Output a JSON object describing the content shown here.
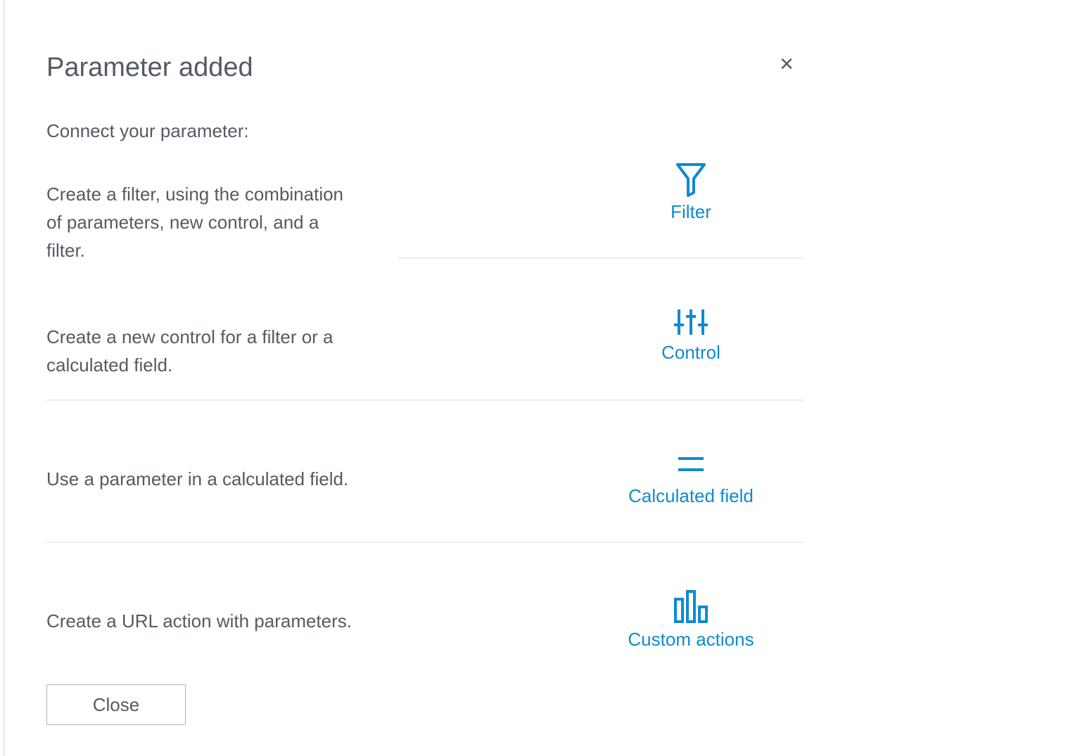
{
  "dialog": {
    "title": "Parameter added",
    "close_icon": "close-icon",
    "subtitle": "Connect your parameter:",
    "options": [
      {
        "description_lines": [
          "Create a filter, using the combination",
          "of parameters, new control, and a",
          "filter."
        ],
        "label": "Filter",
        "icon": "filter-icon"
      },
      {
        "description_lines": [
          "Create a new control for a filter or a",
          "calculated field."
        ],
        "label": "Control",
        "icon": "sliders-icon"
      },
      {
        "description_lines": [
          "Use a parameter in a calculated field."
        ],
        "label": "Calculated field",
        "icon": "equals-icon"
      },
      {
        "description_lines": [
          "Create a URL action with parameters."
        ],
        "label": "Custom actions",
        "icon": "bar-chart-icon"
      }
    ],
    "close_button_label": "Close"
  },
  "colors": {
    "accent": "#0f8ad2",
    "text": "#545b64",
    "divider": "#eaeded",
    "button_border": "#aab7b8"
  }
}
